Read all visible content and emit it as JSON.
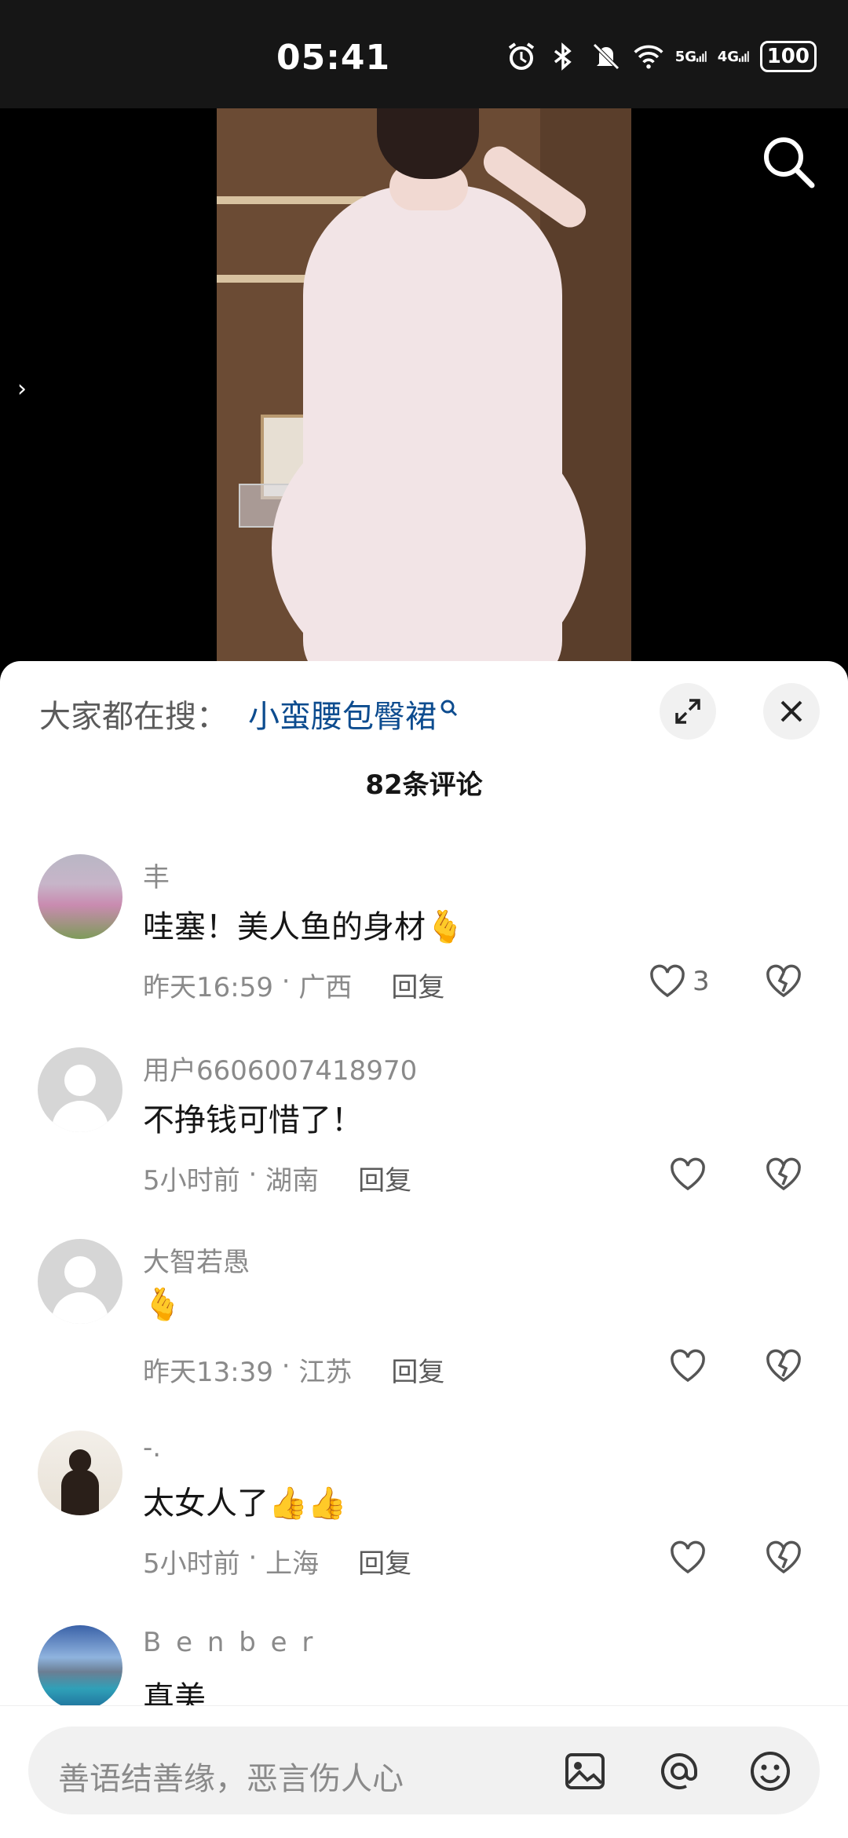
{
  "status_bar": {
    "time": "05:41",
    "battery": "100",
    "signal_5g": "5G",
    "signal_4g": "4G"
  },
  "comments_panel": {
    "search_prefix": "大家都在搜：",
    "search_term": "小蛮腰包臀裙",
    "comment_count": "82条评论",
    "reply_label": "回复",
    "input_placeholder": "善语结善缘，恶言伤人心"
  },
  "comments": [
    {
      "user": "丰",
      "text": "哇塞！美人鱼的身材",
      "emoji": "🫰",
      "time": "昨天16:59",
      "location": "广西",
      "likes": "3",
      "avatar": "flowers"
    },
    {
      "user": "用户6606007418970",
      "text": "不挣钱可惜了！",
      "emoji": "",
      "time": "5小时前",
      "location": "湖南",
      "likes": "",
      "avatar": "default"
    },
    {
      "user": "大智若愚",
      "text": "",
      "emoji": "🫰",
      "time": "昨天13:39",
      "location": "江苏",
      "likes": "",
      "avatar": "default"
    },
    {
      "user": "-.",
      "text": "太女人了",
      "emoji": "👍👍",
      "time": "5小时前",
      "location": "上海",
      "likes": "",
      "avatar": "person"
    },
    {
      "user": "B e n b e r",
      "text": "真美",
      "emoji": "",
      "time": "",
      "location": "",
      "likes": "",
      "avatar": "lake"
    }
  ]
}
